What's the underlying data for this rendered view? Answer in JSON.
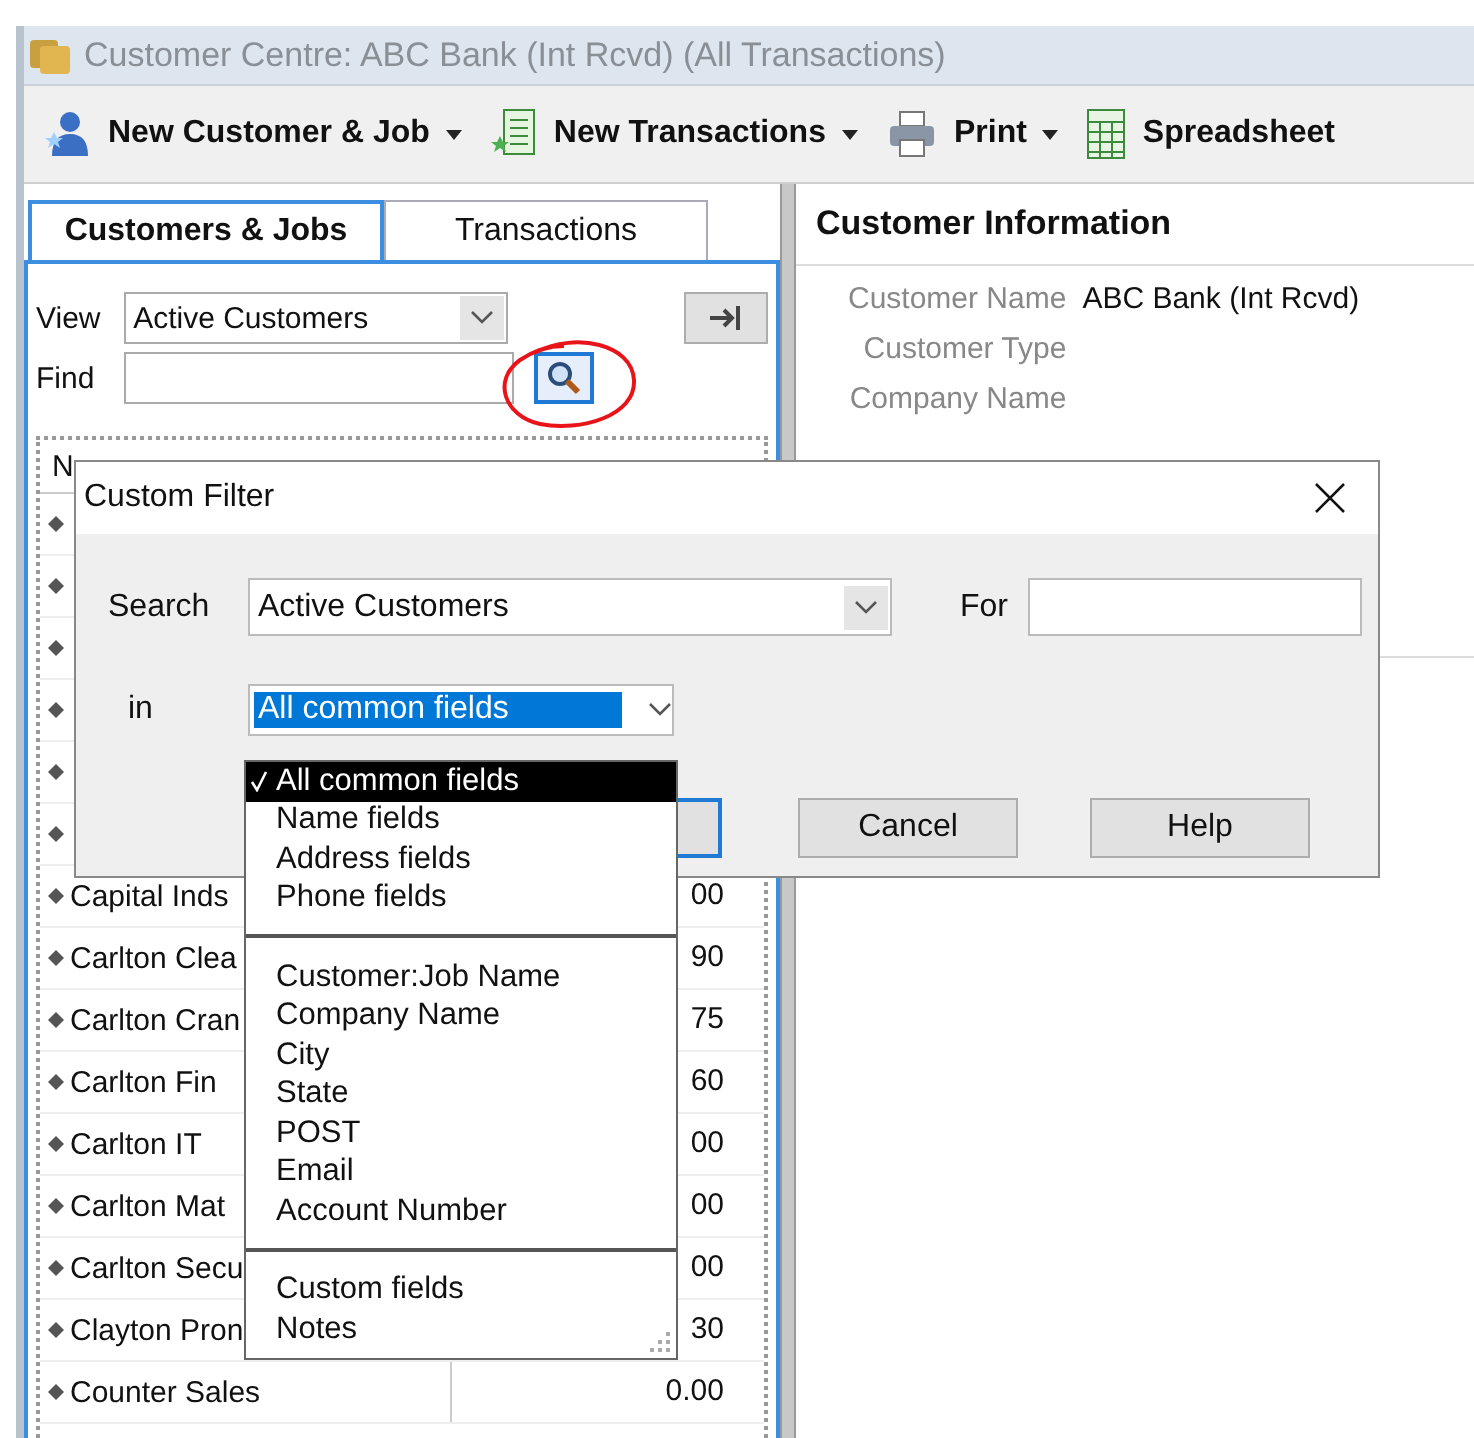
{
  "window": {
    "title": "Customer Centre: ABC Bank (Int Rcvd) (All Transactions)"
  },
  "toolbar": [
    {
      "kind": "customer",
      "label": "New Customer & Job",
      "dropdown": true
    },
    {
      "kind": "transaction",
      "label": "New Transactions",
      "dropdown": true
    },
    {
      "kind": "print",
      "label": "Print",
      "dropdown": true
    },
    {
      "kind": "sheet",
      "label": "Spreadsheet",
      "dropdown": false
    }
  ],
  "tabs": [
    {
      "label": "Customers & Jobs",
      "selected": true
    },
    {
      "label": "Transactions",
      "selected": false
    }
  ],
  "view": {
    "label": "View",
    "value": "Active Customers"
  },
  "find": {
    "label": "Find"
  },
  "list": {
    "column_1": "N",
    "rows": [
      {
        "kind": "covered"
      },
      {
        "kind": "covered"
      },
      {
        "kind": "covered"
      },
      {
        "kind": "covered"
      },
      {
        "kind": "covered"
      },
      {
        "kind": "covered"
      },
      {
        "kind": "customer",
        "name": "Capital Inds",
        "balance": "00"
      },
      {
        "kind": "customer",
        "name": "Carlton Clea",
        "balance": "90"
      },
      {
        "kind": "customer",
        "name": "Carlton Cran",
        "balance": "75"
      },
      {
        "kind": "customer",
        "name": "Carlton Fin",
        "balance": "60"
      },
      {
        "kind": "customer",
        "name": "Carlton IT",
        "balance": "00"
      },
      {
        "kind": "customer",
        "name": "Carlton Mat",
        "balance": "00"
      },
      {
        "kind": "customer",
        "name": "Carlton Secu",
        "balance": "00"
      },
      {
        "kind": "customer",
        "name": "Clayton Pron",
        "balance": "30"
      },
      {
        "kind": "customer",
        "name": "Counter Sales",
        "balance": "0.00"
      }
    ]
  },
  "info": {
    "title": "Customer Information",
    "fields": [
      {
        "label": "Customer Name",
        "value": "ABC Bank (Int Rcvd)"
      },
      {
        "label": "Customer Type"
      },
      {
        "label": "Company Name"
      }
    ]
  },
  "dialog": {
    "title": "Custom Filter",
    "search_label": "Search",
    "search_value": "Active Customers",
    "for_label": "For",
    "in_label": "in",
    "in_value": "All common fields",
    "buttons": [
      {
        "label": "Cancel"
      },
      {
        "label": "Help"
      }
    ],
    "options": [
      [
        {
          "label": "All common fields",
          "selected": true
        },
        {
          "label": "Name fields",
          "selected": false
        },
        {
          "label": "Address fields",
          "selected": false
        },
        {
          "label": "Phone fields",
          "selected": false
        }
      ],
      [
        {
          "label": "Customer:Job Name",
          "selected": false
        },
        {
          "label": "Company Name",
          "selected": false
        },
        {
          "label": "City",
          "selected": false
        },
        {
          "label": "State",
          "selected": false
        },
        {
          "label": "POST",
          "selected": false
        },
        {
          "label": "Email",
          "selected": false
        },
        {
          "label": "Account Number",
          "selected": false
        }
      ],
      [
        {
          "label": "Custom fields",
          "selected": false
        },
        {
          "label": "Notes",
          "selected": false
        }
      ]
    ]
  }
}
